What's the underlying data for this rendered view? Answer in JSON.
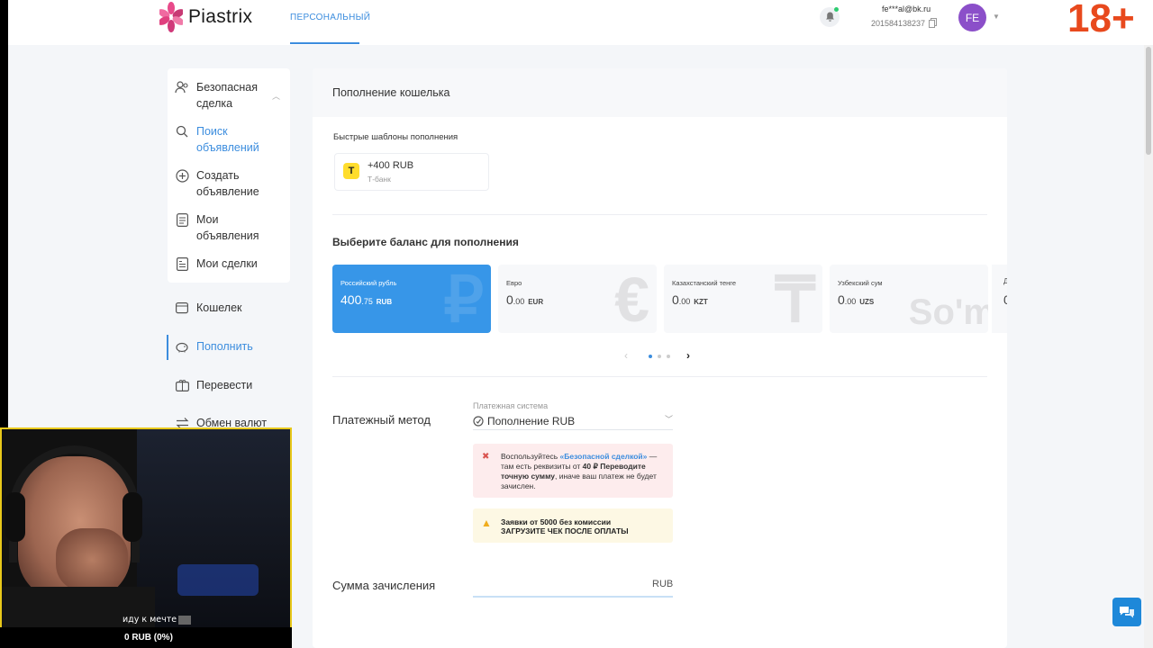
{
  "header": {
    "logo_text": "Piastrix",
    "nav_tab": "ПЕРСОНАЛЬНЫЙ",
    "user_email": "fe***al@bk.ru",
    "user_id": "201584138237",
    "avatar_initials": "FE",
    "age_badge": "18+"
  },
  "sidebar": {
    "safe_deal": {
      "title": "Безопасная сделка",
      "items": [
        {
          "label": "Поиск объявлений",
          "icon": "search-icon"
        },
        {
          "label": "Создать объявление",
          "icon": "plus-circle-icon"
        },
        {
          "label": "Мои объявления",
          "icon": "list-icon"
        },
        {
          "label": "Мои сделки",
          "icon": "document-icon"
        }
      ]
    },
    "items": [
      {
        "label": "Кошелек",
        "icon": "wallet-icon"
      },
      {
        "label": "Пополнить",
        "icon": "piggy-bank-icon"
      },
      {
        "label": "Перевести",
        "icon": "transfer-icon"
      },
      {
        "label": "Обмен валют",
        "icon": "exchange-icon"
      }
    ]
  },
  "main": {
    "title": "Пополнение кошелька",
    "templates_label": "Быстрые шаблоны пополнения",
    "template": {
      "amount": "+400 RUB",
      "bank": "Т-банк",
      "icon_letter": "T"
    },
    "balances_label": "Выберите баланс для пополнения",
    "balances": [
      {
        "name": "Российский рубль",
        "int": "400",
        "dec": ".75",
        "currency": "RUB",
        "symbol": "₽"
      },
      {
        "name": "Евро",
        "int": "0",
        "dec": ".00",
        "currency": "EUR",
        "symbol": "€"
      },
      {
        "name": "Казахстанский тенге",
        "int": "0",
        "dec": ".00",
        "currency": "KZT",
        "symbol": "₸"
      },
      {
        "name": "Узбекский сум",
        "int": "0",
        "dec": ".00",
        "currency": "UZS",
        "symbol": "So'm"
      }
    ],
    "balance_partial_letter": "Д",
    "balance_partial_amount": "0",
    "payment_method_label": "Платежный метод",
    "payment_system_caption": "Платежная система",
    "payment_system_value": "Пополнение RUB",
    "warning_red": {
      "prefix": "Воспользуйтесь ",
      "link": "«Безопасной сделкой»",
      "mid": " — там есть реквизиты от ",
      "min": "40 ₽",
      "bold": "Переводите точную сумму",
      "suffix": ", иначе ваш платеж не будет зачислен."
    },
    "warning_yellow": {
      "line1": "Заявки от 5000 без комиссии",
      "line2": "ЗАГРУЗИТЕ ЧЕК ПОСЛЕ ОПЛАТЫ"
    },
    "sum_label": "Сумма зачисления",
    "sum_currency": "RUB"
  },
  "overlay": {
    "caption": "иду к мечте",
    "progress": "0 RUB (0%)"
  },
  "colors": {
    "accent": "#3c8dde",
    "active_balance": "#3796e8",
    "age_badge": "#e8491d",
    "avatar": "#8b4fc9"
  }
}
